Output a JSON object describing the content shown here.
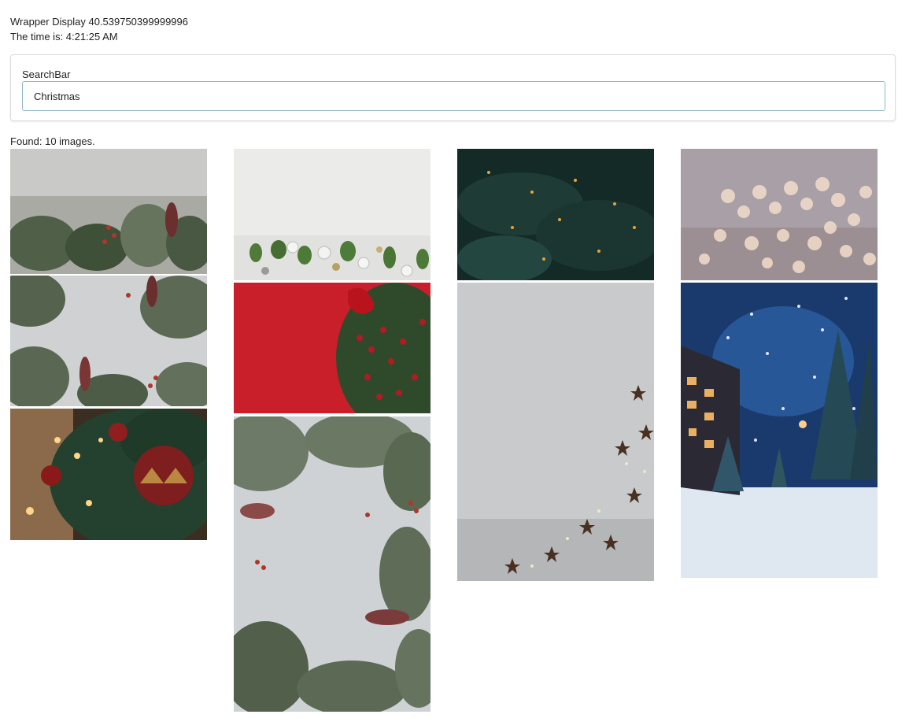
{
  "header": {
    "wrapper_display": "Wrapper Display 40.539750399999996",
    "time_text": "The time is: 4:21:25 AM"
  },
  "search": {
    "label": "SearchBar",
    "value": "Christmas"
  },
  "results": {
    "found_text": "Found: 10 images."
  },
  "images": [
    {
      "name": "image-1",
      "subject": "greenery on grey stone"
    },
    {
      "name": "image-2",
      "subject": "greenery frame on grey"
    },
    {
      "name": "image-3",
      "subject": "christmas tree ornaments bokeh"
    },
    {
      "name": "image-4",
      "subject": "white ornaments and leaves"
    },
    {
      "name": "image-5",
      "subject": "red background with berries"
    },
    {
      "name": "image-6",
      "subject": "eucalyptus frame on grey"
    },
    {
      "name": "image-7",
      "subject": "dark fir branches with lights"
    },
    {
      "name": "image-8",
      "subject": "grey background with gold stars"
    },
    {
      "name": "image-9",
      "subject": "warm bokeh lights"
    },
    {
      "name": "image-10",
      "subject": "snowy town at night"
    }
  ]
}
